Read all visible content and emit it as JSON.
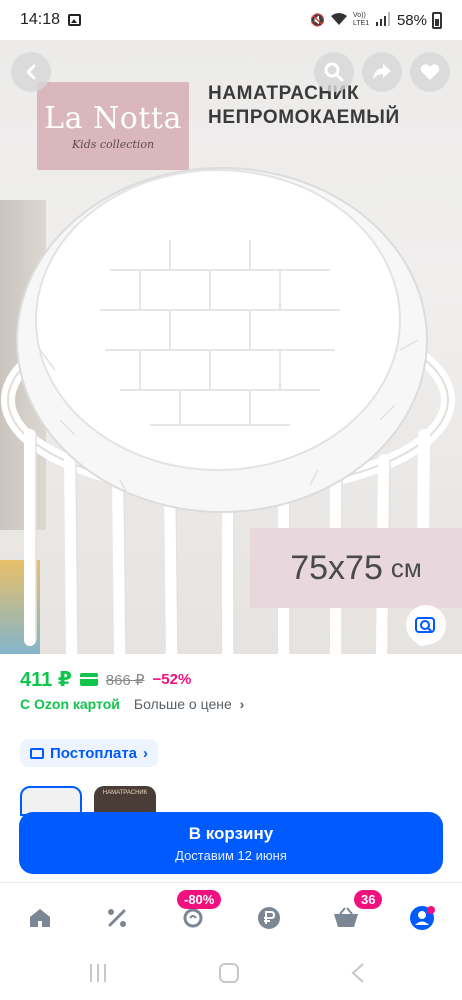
{
  "status_bar": {
    "time": "14:18",
    "network_label": "Vo)) LTE1",
    "battery": "58%"
  },
  "product": {
    "brand_name": "La Notta",
    "brand_sub": "Kids collection",
    "headline_line1": "НАМАТРАСНИК",
    "headline_line2": "НЕПРОМОКАЕМЫЙ",
    "size_value": "75x75",
    "size_unit": "см"
  },
  "price": {
    "current": "411 ₽",
    "old": "866 ₽",
    "discount": "−52%",
    "ozon_card_label": "С Ozon картой",
    "more_about_price": "Больше о цене"
  },
  "postpay": {
    "label": "Постоплата"
  },
  "thumbnail_2_text": "НАМАТРАСНИК",
  "cart": {
    "title": "В корзину",
    "subtitle": "Доставим 12 июня"
  },
  "tabbar": {
    "items": [
      {
        "icon": "home-icon"
      },
      {
        "icon": "percent-icon"
      },
      {
        "icon": "fresh-icon",
        "badge": "-80%"
      },
      {
        "icon": "ruble-icon"
      },
      {
        "icon": "cart-icon",
        "badge": "36"
      },
      {
        "icon": "profile-icon"
      }
    ]
  },
  "colors": {
    "accent": "#005bff",
    "price_green": "#10c44c",
    "discount_pink": "#f1117e"
  }
}
